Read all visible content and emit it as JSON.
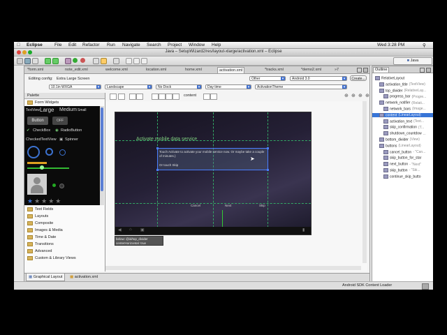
{
  "menubar": {
    "app": "Eclipse",
    "items": [
      "File",
      "Edit",
      "Refactor",
      "Run",
      "Navigate",
      "Search",
      "Project",
      "Window",
      "Help"
    ],
    "clock": "Wed 3:28 PM"
  },
  "window": {
    "title": "Java – SetupWizard2/res/layout-xlarge/activation.xml – Eclipse"
  },
  "perspective": {
    "label": "Java"
  },
  "editor_tabs": [
    "*form.xml",
    "note_edit.xml",
    "welcome.xml",
    "location.xml",
    "home.xml",
    "activation.xml",
    "*tracks.xml",
    "*demo2.xml"
  ],
  "editor_tabs_overflow": "»7",
  "config": {
    "editing_label": "Editing config:",
    "editing_value": "Extra Large Screen",
    "other": "Other",
    "android": "Android 3.0",
    "create": "Create...",
    "screen": "10.1in WXGA",
    "orientation": "Landscape",
    "dock": "No Dock",
    "daytime": "Day time",
    "theme": "ActivationTheme"
  },
  "canvas_toolbar": {
    "content_label": "content"
  },
  "palette": {
    "title": "Palette",
    "form_widgets": "Form Widgets",
    "textviews": [
      "TextView",
      "Large",
      "Medium",
      "Small"
    ],
    "button": "Button",
    "toggle_off": "OFF",
    "checkbox": "CheckBox",
    "radio": "RadioButton",
    "checked_text": "CheckedTextView",
    "spinner": "Spinner",
    "categories": [
      "Text Fields",
      "Layouts",
      "Composite",
      "Images & Media",
      "Time & Date",
      "Transitions",
      "Advanced",
      "Custom & Library Views"
    ]
  },
  "device": {
    "title": "Activate mobile data service",
    "message": "Touch Activate to activate your mobile service now. Or maybe take a couple of minutes.)",
    "touch_skip": "Or touch Skip",
    "cancel": "Cancel",
    "next": "Next",
    "skip": "Skip"
  },
  "tooltip": {
    "line1": "below: @id/top_divider",
    "line2": "centerHorizontal: true"
  },
  "editor_bottom_tabs": [
    "Graphical Layout",
    "activation.xml"
  ],
  "outline": {
    "title": "Outline",
    "items": [
      {
        "level": 0,
        "name": "RelativeLayout",
        "type": ""
      },
      {
        "level": 1,
        "name": "activation_title",
        "type": "(TextView)"
      },
      {
        "level": 1,
        "name": "top_divider",
        "type": "(RelativeLay..."
      },
      {
        "level": 2,
        "name": "progress_bar",
        "type": "(Progre..."
      },
      {
        "level": 1,
        "name": "network_notifier",
        "type": "(Relati..."
      },
      {
        "level": 2,
        "name": "network_bars",
        "type": "(Image..."
      },
      {
        "level": 1,
        "name": "content",
        "type": "(LinearLayout)",
        "selected": true
      },
      {
        "level": 2,
        "name": "activation_text",
        "type": "(Text..."
      },
      {
        "level": 2,
        "name": "skip_confirmation",
        "type": "(T..."
      },
      {
        "level": 2,
        "name": "shutdown_countdow",
        "type": "..."
      },
      {
        "level": 1,
        "name": "bottom_divider",
        "type": "(View)"
      },
      {
        "level": 1,
        "name": "buttons",
        "type": "(LinearLayout)"
      },
      {
        "level": 2,
        "name": "cancel_button",
        "type": "- \"Can..."
      },
      {
        "level": 2,
        "name": "skip_button_for_star",
        "type": ""
      },
      {
        "level": 2,
        "name": "next_button",
        "type": "- \"Next\""
      },
      {
        "level": 2,
        "name": "skip_button",
        "type": "- \"Ski..."
      },
      {
        "level": 2,
        "name": "continue_skip_butto",
        "type": ""
      }
    ]
  },
  "status": {
    "text": "Android SDK Content Loader"
  },
  "colors": {
    "accent": "#3f6fcf",
    "device_text": "#7fd07f",
    "selection": "#4a7fff"
  }
}
